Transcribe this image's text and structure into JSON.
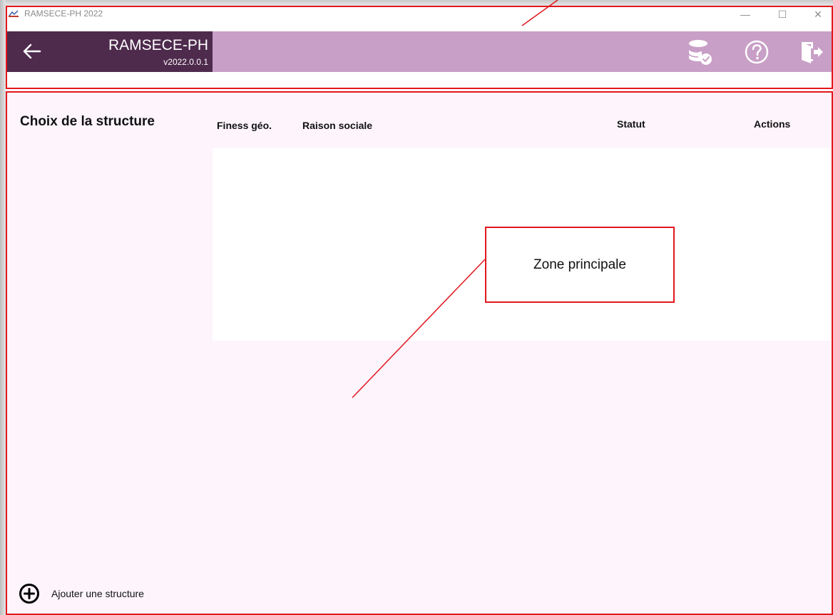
{
  "window": {
    "title": "RAMSECE-PH 2022",
    "controls": {
      "minimize": "—",
      "maximize": "☐",
      "close": "✕"
    }
  },
  "header": {
    "app_name": "RAMSECE-PH",
    "version": "v2022.0.0.1",
    "icons": [
      "database-check-icon",
      "help-icon",
      "logout-icon"
    ]
  },
  "main": {
    "title": "Choix de la structure",
    "columns": [
      "Finess géo.",
      "Raison sociale",
      "Statut",
      "Actions"
    ],
    "rows": [],
    "add_button_label": "Ajouter une structure"
  },
  "annotation": {
    "callout_text": "Zone principale"
  },
  "colors": {
    "brand_dark": "#4e2a4d",
    "header_bg": "#c89fc6",
    "main_bg": "#fdf4fc",
    "annotation_red": "#e1171e"
  }
}
